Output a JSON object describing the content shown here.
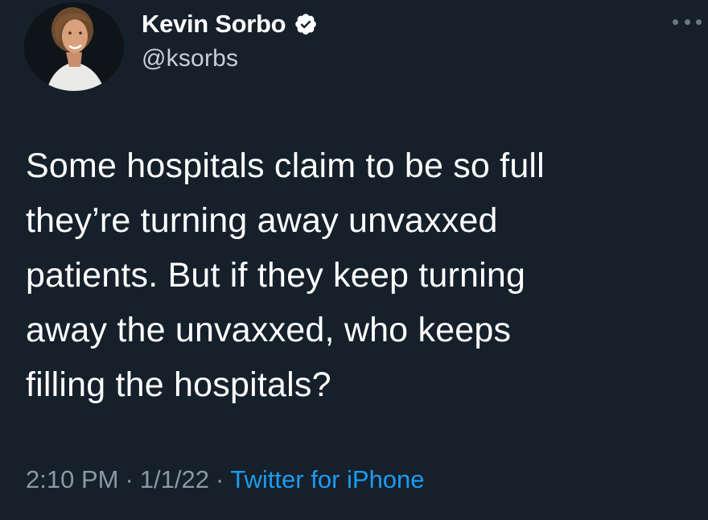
{
  "author": {
    "display_name": "Kevin Sorbo",
    "handle": "@ksorbs",
    "verified_icon": "verified-badge-icon",
    "avatar_icon": "profile-photo"
  },
  "tweet": {
    "lines": [
      "Some hospitals claim to be so full",
      "they’re turning away unvaxxed",
      "patients. But if they keep turning",
      "away the unvaxxed, who keeps",
      "filling the hospitals?"
    ]
  },
  "meta": {
    "time": "2:10 PM",
    "separator": "·",
    "date": "1/1/22",
    "source": "Twitter for iPhone"
  },
  "menu": {
    "icon": "more-options-icon"
  },
  "colors": {
    "background": "#15202b",
    "text": "#ffffff",
    "secondary_text": "#8b98a5",
    "link": "#1d9bf0"
  }
}
